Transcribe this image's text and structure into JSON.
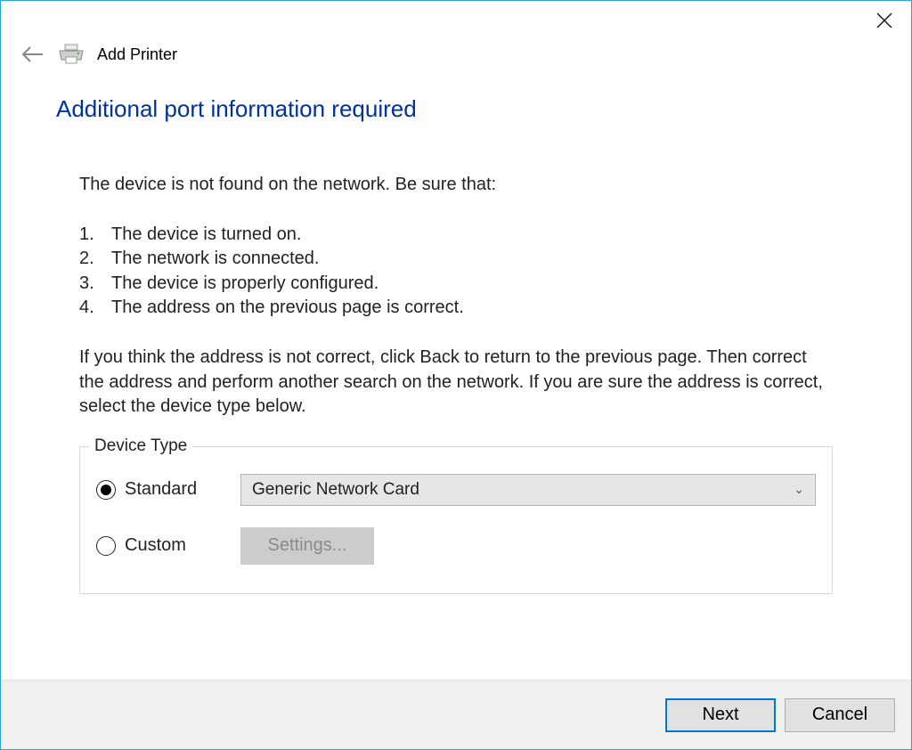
{
  "titlebar": {
    "close_label": "Close"
  },
  "header": {
    "back_label": "Back",
    "icon_label": "printer",
    "title": "Add Printer"
  },
  "heading": "Additional port information required",
  "intro": "The device is not found on the network.  Be sure that:",
  "steps": [
    {
      "n": "1.",
      "t": "The device is turned on."
    },
    {
      "n": "2.",
      "t": "The network is connected."
    },
    {
      "n": "3.",
      "t": "The device is properly configured."
    },
    {
      "n": "4.",
      "t": "The address on the previous page is correct."
    }
  ],
  "para": "If you think the address is not correct, click Back to return to the previous page.  Then correct the address and perform another search on the network.  If you are sure the address is correct, select the device type below.",
  "device_type": {
    "legend": "Device Type",
    "standard_label": "Standard",
    "custom_label": "Custom",
    "select_value": "Generic Network Card",
    "settings_label": "Settings..."
  },
  "footer": {
    "next": "Next",
    "cancel": "Cancel"
  }
}
